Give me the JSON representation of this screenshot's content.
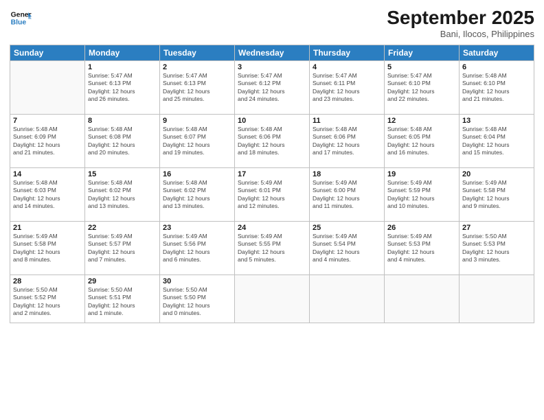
{
  "header": {
    "logo_line1": "General",
    "logo_line2": "Blue",
    "month": "September 2025",
    "location": "Bani, Ilocos, Philippines"
  },
  "days_of_week": [
    "Sunday",
    "Monday",
    "Tuesday",
    "Wednesday",
    "Thursday",
    "Friday",
    "Saturday"
  ],
  "weeks": [
    [
      {
        "day": "",
        "info": ""
      },
      {
        "day": "1",
        "info": "Sunrise: 5:47 AM\nSunset: 6:13 PM\nDaylight: 12 hours\nand 26 minutes."
      },
      {
        "day": "2",
        "info": "Sunrise: 5:47 AM\nSunset: 6:13 PM\nDaylight: 12 hours\nand 25 minutes."
      },
      {
        "day": "3",
        "info": "Sunrise: 5:47 AM\nSunset: 6:12 PM\nDaylight: 12 hours\nand 24 minutes."
      },
      {
        "day": "4",
        "info": "Sunrise: 5:47 AM\nSunset: 6:11 PM\nDaylight: 12 hours\nand 23 minutes."
      },
      {
        "day": "5",
        "info": "Sunrise: 5:47 AM\nSunset: 6:10 PM\nDaylight: 12 hours\nand 22 minutes."
      },
      {
        "day": "6",
        "info": "Sunrise: 5:48 AM\nSunset: 6:10 PM\nDaylight: 12 hours\nand 21 minutes."
      }
    ],
    [
      {
        "day": "7",
        "info": "Sunrise: 5:48 AM\nSunset: 6:09 PM\nDaylight: 12 hours\nand 21 minutes."
      },
      {
        "day": "8",
        "info": "Sunrise: 5:48 AM\nSunset: 6:08 PM\nDaylight: 12 hours\nand 20 minutes."
      },
      {
        "day": "9",
        "info": "Sunrise: 5:48 AM\nSunset: 6:07 PM\nDaylight: 12 hours\nand 19 minutes."
      },
      {
        "day": "10",
        "info": "Sunrise: 5:48 AM\nSunset: 6:06 PM\nDaylight: 12 hours\nand 18 minutes."
      },
      {
        "day": "11",
        "info": "Sunrise: 5:48 AM\nSunset: 6:06 PM\nDaylight: 12 hours\nand 17 minutes."
      },
      {
        "day": "12",
        "info": "Sunrise: 5:48 AM\nSunset: 6:05 PM\nDaylight: 12 hours\nand 16 minutes."
      },
      {
        "day": "13",
        "info": "Sunrise: 5:48 AM\nSunset: 6:04 PM\nDaylight: 12 hours\nand 15 minutes."
      }
    ],
    [
      {
        "day": "14",
        "info": "Sunrise: 5:48 AM\nSunset: 6:03 PM\nDaylight: 12 hours\nand 14 minutes."
      },
      {
        "day": "15",
        "info": "Sunrise: 5:48 AM\nSunset: 6:02 PM\nDaylight: 12 hours\nand 13 minutes."
      },
      {
        "day": "16",
        "info": "Sunrise: 5:48 AM\nSunset: 6:02 PM\nDaylight: 12 hours\nand 13 minutes."
      },
      {
        "day": "17",
        "info": "Sunrise: 5:49 AM\nSunset: 6:01 PM\nDaylight: 12 hours\nand 12 minutes."
      },
      {
        "day": "18",
        "info": "Sunrise: 5:49 AM\nSunset: 6:00 PM\nDaylight: 12 hours\nand 11 minutes."
      },
      {
        "day": "19",
        "info": "Sunrise: 5:49 AM\nSunset: 5:59 PM\nDaylight: 12 hours\nand 10 minutes."
      },
      {
        "day": "20",
        "info": "Sunrise: 5:49 AM\nSunset: 5:58 PM\nDaylight: 12 hours\nand 9 minutes."
      }
    ],
    [
      {
        "day": "21",
        "info": "Sunrise: 5:49 AM\nSunset: 5:58 PM\nDaylight: 12 hours\nand 8 minutes."
      },
      {
        "day": "22",
        "info": "Sunrise: 5:49 AM\nSunset: 5:57 PM\nDaylight: 12 hours\nand 7 minutes."
      },
      {
        "day": "23",
        "info": "Sunrise: 5:49 AM\nSunset: 5:56 PM\nDaylight: 12 hours\nand 6 minutes."
      },
      {
        "day": "24",
        "info": "Sunrise: 5:49 AM\nSunset: 5:55 PM\nDaylight: 12 hours\nand 5 minutes."
      },
      {
        "day": "25",
        "info": "Sunrise: 5:49 AM\nSunset: 5:54 PM\nDaylight: 12 hours\nand 4 minutes."
      },
      {
        "day": "26",
        "info": "Sunrise: 5:49 AM\nSunset: 5:53 PM\nDaylight: 12 hours\nand 4 minutes."
      },
      {
        "day": "27",
        "info": "Sunrise: 5:50 AM\nSunset: 5:53 PM\nDaylight: 12 hours\nand 3 minutes."
      }
    ],
    [
      {
        "day": "28",
        "info": "Sunrise: 5:50 AM\nSunset: 5:52 PM\nDaylight: 12 hours\nand 2 minutes."
      },
      {
        "day": "29",
        "info": "Sunrise: 5:50 AM\nSunset: 5:51 PM\nDaylight: 12 hours\nand 1 minute."
      },
      {
        "day": "30",
        "info": "Sunrise: 5:50 AM\nSunset: 5:50 PM\nDaylight: 12 hours\nand 0 minutes."
      },
      {
        "day": "",
        "info": ""
      },
      {
        "day": "",
        "info": ""
      },
      {
        "day": "",
        "info": ""
      },
      {
        "day": "",
        "info": ""
      }
    ]
  ]
}
